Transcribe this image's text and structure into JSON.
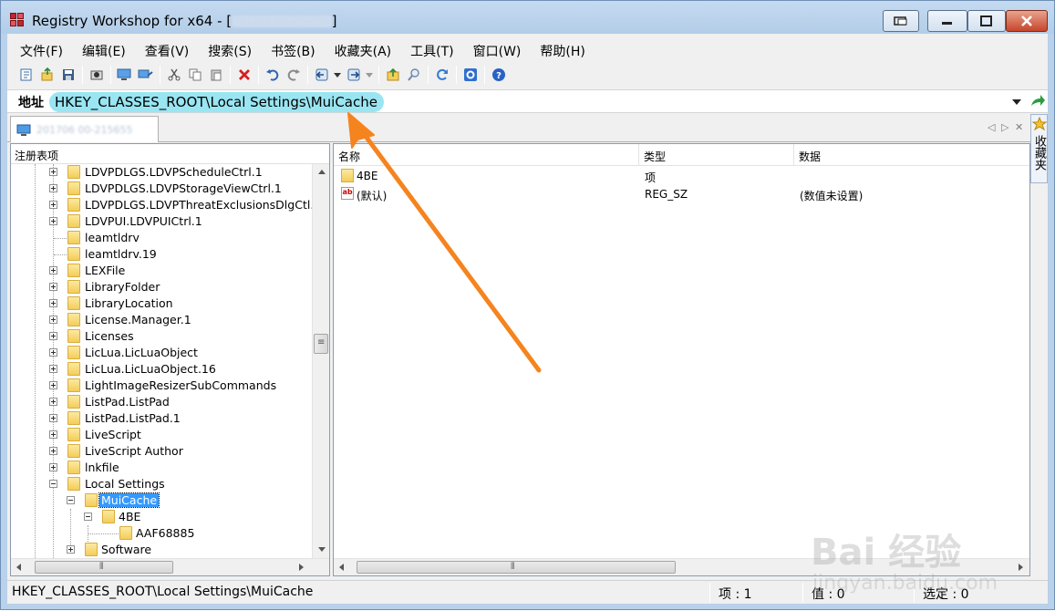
{
  "window": {
    "title_prefix": "Registry Workshop for x64 - [",
    "title_machine": "201706 00-215655",
    "title_suffix": "]"
  },
  "menu": [
    {
      "label": "文件(F)"
    },
    {
      "label": "编辑(E)"
    },
    {
      "label": "查看(V)"
    },
    {
      "label": "搜索(S)"
    },
    {
      "label": "书签(B)"
    },
    {
      "label": "收藏夹(A)"
    },
    {
      "label": "工具(T)"
    },
    {
      "label": "窗口(W)"
    },
    {
      "label": "帮助(H)"
    }
  ],
  "toolbar": {
    "icons": [
      "open-icon",
      "export-icon",
      "save-icon",
      "print-preview-icon",
      "connect-icon",
      "disconnect-icon",
      "cut-icon",
      "copy-icon",
      "paste-icon",
      "delete-icon",
      "undo-icon",
      "redo-icon",
      "back-icon",
      "forward-icon",
      "up-level-icon",
      "find-icon",
      "refresh-icon",
      "options-icon",
      "help-icon"
    ]
  },
  "address": {
    "label": "地址",
    "value": "HKEY_CLASSES_ROOT\\Local Settings\\MuiCache"
  },
  "tab": {
    "label": "201706 00-215655"
  },
  "favorites": {
    "label": "收藏夹"
  },
  "tree": {
    "header": "注册表项",
    "items": [
      {
        "label": "LDVPDLGS.LDVPScheduleCtrl.1"
      },
      {
        "label": "LDVPDLGS.LDVPStorageViewCtrl.1"
      },
      {
        "label": "LDVPDLGS.LDVPThreatExclusionsDlgCtl.1"
      },
      {
        "label": "LDVPUI.LDVPUICtrl.1"
      },
      {
        "label": "leamtldrv"
      },
      {
        "label": "leamtldrv.19"
      },
      {
        "label": "LEXFile"
      },
      {
        "label": "LibraryFolder"
      },
      {
        "label": "LibraryLocation"
      },
      {
        "label": "License.Manager.1"
      },
      {
        "label": "Licenses"
      },
      {
        "label": "LicLua.LicLuaObject"
      },
      {
        "label": "LicLua.LicLuaObject.16"
      },
      {
        "label": "LightImageResizerSubCommands"
      },
      {
        "label": "ListPad.ListPad"
      },
      {
        "label": "ListPad.ListPad.1"
      },
      {
        "label": "LiveScript"
      },
      {
        "label": "LiveScript Author"
      },
      {
        "label": "lnkfile"
      },
      {
        "label": "Local Settings"
      },
      {
        "label": "MuiCache"
      },
      {
        "label": "4BE"
      },
      {
        "label": "AAF68885"
      },
      {
        "label": "Software"
      }
    ]
  },
  "list": {
    "columns": [
      "名称",
      "类型",
      "数据"
    ],
    "rows": [
      {
        "name": "4BE",
        "type": "项",
        "data": ""
      },
      {
        "name": "(默认)",
        "type": "REG_SZ",
        "data": "(数值未设置)"
      }
    ]
  },
  "status": {
    "path": "HKEY_CLASSES_ROOT\\Local Settings\\MuiCache",
    "keys": "项 : 1",
    "values": "值 : 0",
    "selected": "选定 : 0"
  },
  "watermark": {
    "logo": "Bai 经验",
    "url": "jingyan.baidu.com"
  },
  "colors": {
    "address_highlight": "#9ae5f2",
    "selection": "#3399ff",
    "annotation_arrow": "#f5841f",
    "close_button": "#c7452b"
  }
}
